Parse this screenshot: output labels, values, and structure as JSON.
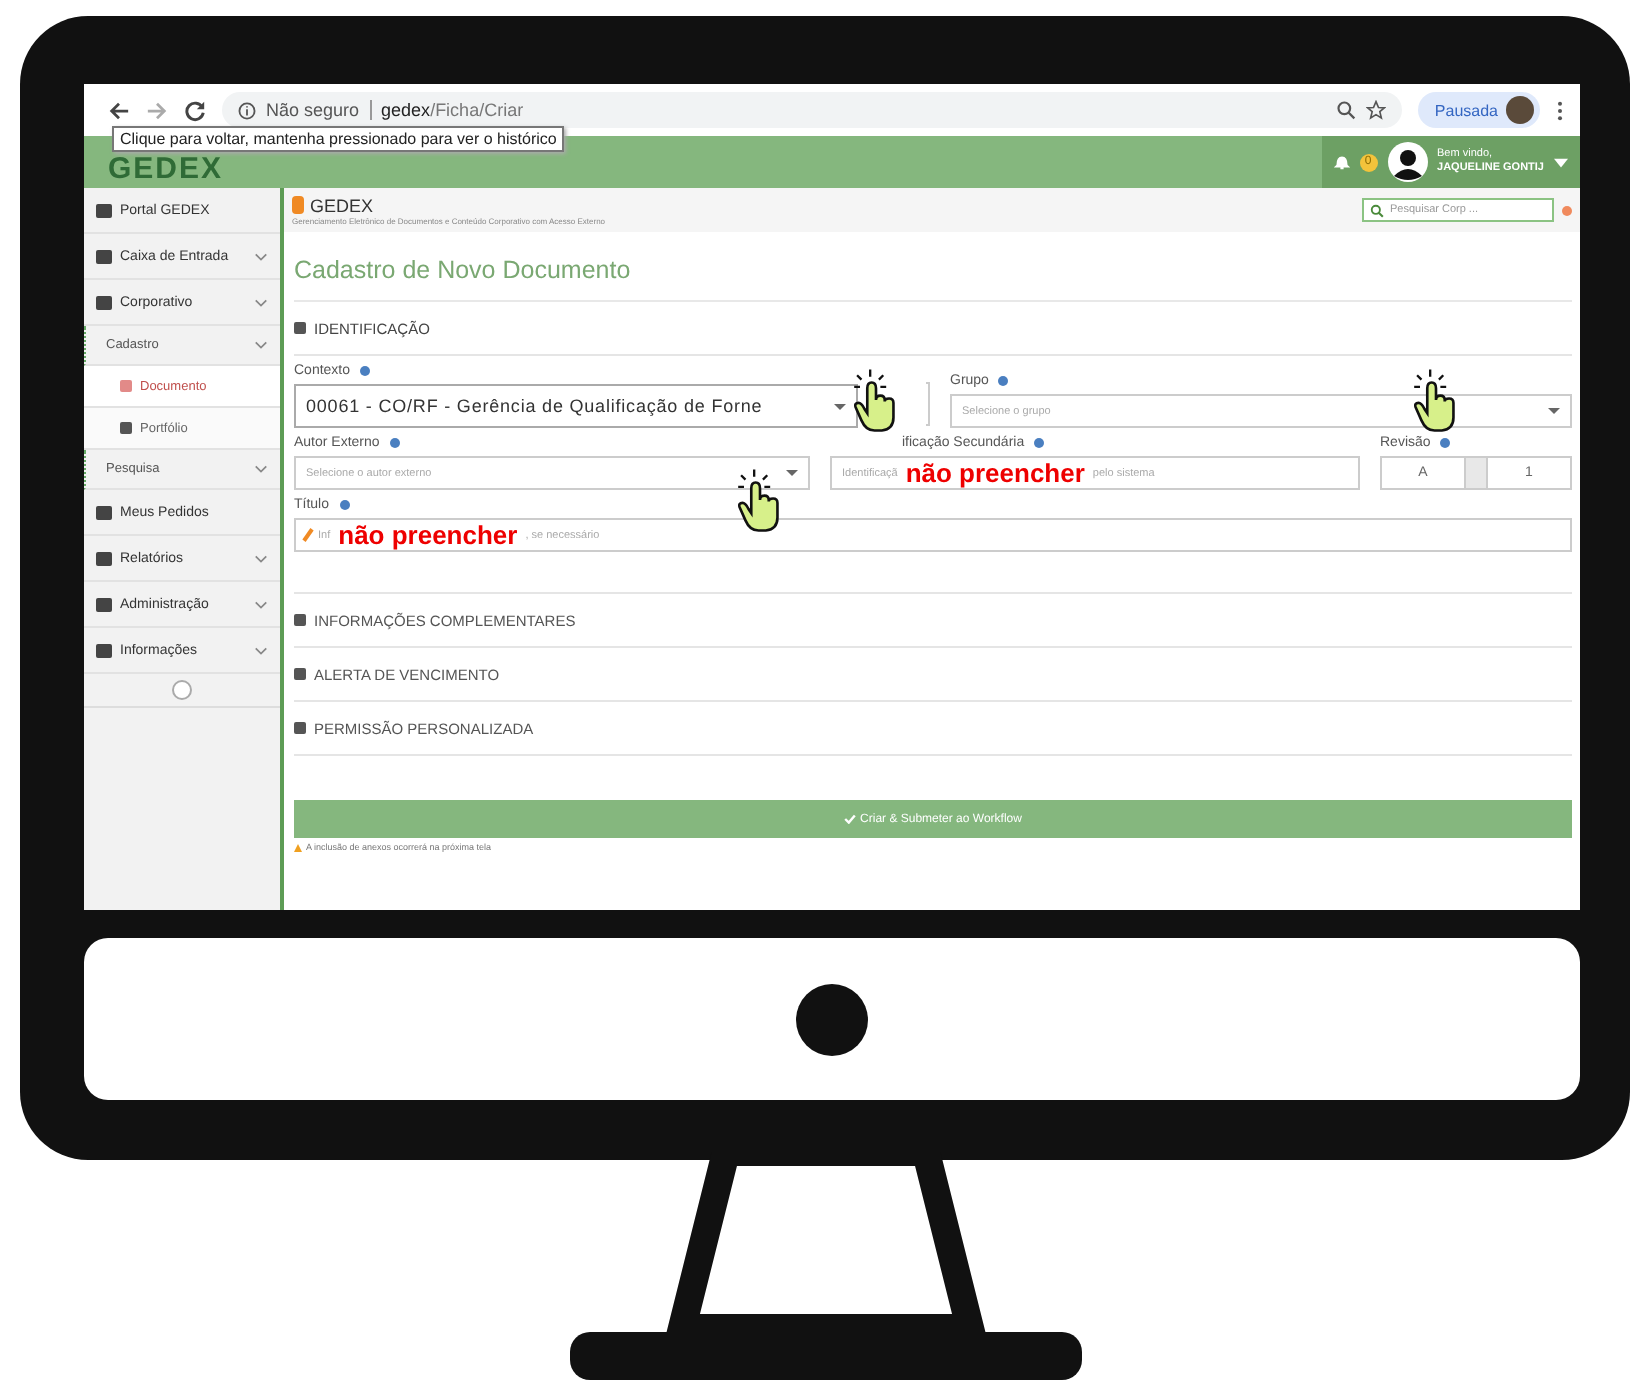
{
  "browser": {
    "security": "Não seguro",
    "host": "gedex",
    "path": "/Ficha/Criar",
    "tooltip": "Clique para voltar, mantenha pressionado para ver o histórico",
    "profile": "Pausada"
  },
  "app_header": {
    "logo": "GEDEX",
    "notification_count": "0",
    "greeting": "Bem vindo,",
    "user": "JAQUELINE GONTIJ"
  },
  "sidebar": {
    "items": [
      {
        "label": "Portal GEDEX",
        "expandable": false,
        "selected": false
      },
      {
        "label": "Caixa de Entrada",
        "expandable": true,
        "selected": false
      },
      {
        "label": "Corporativo",
        "expandable": true,
        "selected": false,
        "children": [
          {
            "label": "Cadastro",
            "expandable": true,
            "selected": false,
            "children": [
              {
                "label": "Documento",
                "expandable": false,
                "selected": true
              },
              {
                "label": "Portfólio",
                "expandable": false,
                "selected": false
              }
            ]
          },
          {
            "label": "Pesquisa",
            "expandable": true,
            "selected": false
          }
        ]
      },
      {
        "label": "Meus Pedidos",
        "expandable": false,
        "selected": false
      },
      {
        "label": "Relatórios",
        "expandable": true,
        "selected": false
      },
      {
        "label": "Administração",
        "expandable": true,
        "selected": false
      },
      {
        "label": "Informações",
        "expandable": true,
        "selected": false
      }
    ]
  },
  "subheader": {
    "brand": "GEDEX",
    "subtitle": "Gerenciamento Eletrônico de Documentos e Conteúdo Corporativo com Acesso Externo",
    "search_placeholder": "Pesquisar Corp ..."
  },
  "page_title": "Cadastro de Novo Documento",
  "sections": [
    {
      "title": "IDENTIFICAÇÃO",
      "expanded": true
    },
    {
      "title": "INFORMAÇÕES COMPLEMENTARES",
      "expanded": false
    },
    {
      "title": "ALERTA DE VENCIMENTO",
      "expanded": false
    },
    {
      "title": "PERMISSÃO PERSONALIZADA",
      "expanded": false
    }
  ],
  "form": {
    "contexto": {
      "label": "Contexto",
      "value": "00061 - CO/RF - Gerência de Qualificação de Forne"
    },
    "grupo": {
      "label": "Grupo",
      "placeholder": "Selecione o grupo"
    },
    "autor": {
      "label": "Autor Externo",
      "placeholder": "Selecione o autor externo"
    },
    "identificacao": {
      "label": "ificação Secundária",
      "placeholder_start": "Identificaçã",
      "annotation": "não preencher",
      "placeholder_end": "pelo sistema"
    },
    "revisao": {
      "label": "Revisão",
      "letter": "A",
      "number": "1"
    },
    "titulo": {
      "label": "Título",
      "placeholder_start": "Inf",
      "annotation": "não preencher",
      "placeholder_end": ", se necessário"
    }
  },
  "submit": "Criar & Submeter ao Workflow",
  "note": "A inclusão de anexos ocorrerá na próxima tela"
}
